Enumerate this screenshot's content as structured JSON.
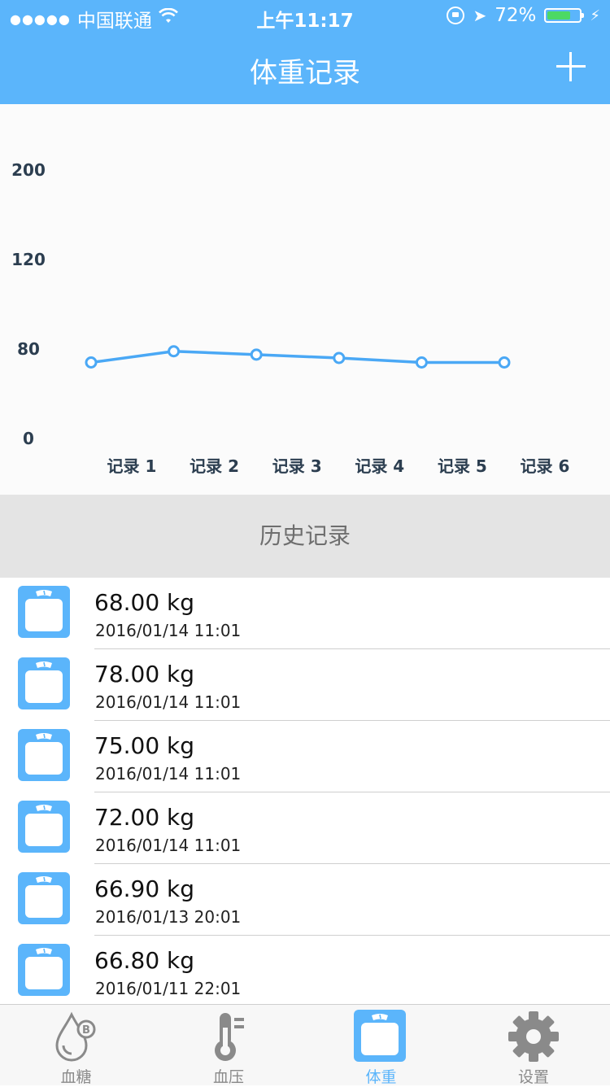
{
  "status_bar": {
    "carrier": "中国联通",
    "time": "上午11:17",
    "battery_percent": "72%",
    "battery_level": 0.72,
    "icons": [
      "signal-icon",
      "wifi-icon",
      "rotation-lock-icon",
      "location-arrow-icon",
      "battery-icon",
      "charging-bolt-icon"
    ]
  },
  "nav": {
    "title": "体重记录",
    "add_icon": "plus-icon"
  },
  "colors": {
    "accent": "#5bb5fb",
    "line": "#4aa8f5",
    "section_bg": "#e4e4e4",
    "tab_inactive": "#8a8a8a"
  },
  "chart_data": {
    "type": "line",
    "categories": [
      "记录 1",
      "记录 2",
      "记录 3",
      "记录 4",
      "记录 5",
      "记录 6"
    ],
    "series": [
      {
        "values": [
          68.0,
          78.0,
          75.0,
          72.0,
          68.0,
          68.0
        ]
      }
    ],
    "y_ticks": [
      "200",
      "120",
      "80",
      "0"
    ],
    "title": "",
    "xlabel": "",
    "ylabel": "",
    "grid": false
  },
  "history": {
    "header": "历史记录",
    "items": [
      {
        "weight": "68.00 kg",
        "date": "2016/01/14 11:01"
      },
      {
        "weight": "78.00 kg",
        "date": "2016/01/14 11:01"
      },
      {
        "weight": "75.00 kg",
        "date": "2016/01/14 11:01"
      },
      {
        "weight": "72.00 kg",
        "date": "2016/01/14 11:01"
      },
      {
        "weight": "66.90 kg",
        "date": "2016/01/13 20:01"
      },
      {
        "weight": "66.80 kg",
        "date": "2016/01/11 22:01"
      }
    ]
  },
  "tabs": [
    {
      "label": "血糖",
      "icon": "blood-sugar-drop-icon",
      "active": false
    },
    {
      "label": "血压",
      "icon": "thermometer-icon",
      "active": false
    },
    {
      "label": "体重",
      "icon": "scale-icon",
      "active": true
    },
    {
      "label": "设置",
      "icon": "gear-icon",
      "active": false
    }
  ]
}
